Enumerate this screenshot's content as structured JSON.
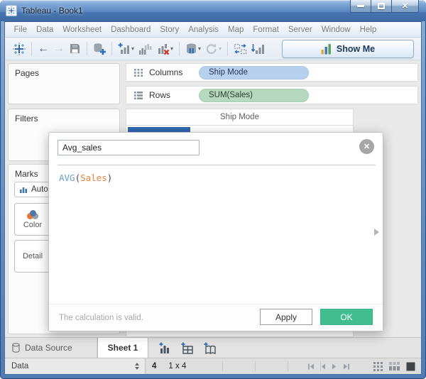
{
  "window": {
    "title": "Tableau - Book1"
  },
  "icons": {
    "minimize": "minimize",
    "maximize": "maximize",
    "close": "✕",
    "caret": "▾",
    "back": "←",
    "forward": "→",
    "dialog_close": "✕"
  },
  "menu": {
    "items": [
      "File",
      "Data",
      "Worksheet",
      "Dashboard",
      "Story",
      "Analysis",
      "Map",
      "Format",
      "Server",
      "Window",
      "Help"
    ]
  },
  "toolbar": {
    "show_me_label": "Show Me"
  },
  "left_panel": {
    "pages_label": "Pages",
    "filters_label": "Filters",
    "marks_label": "Marks",
    "marks_type_label": "Automatic",
    "color_label": "Color",
    "detail_label": "Detail"
  },
  "shelves": {
    "columns_label": "Columns",
    "columns_pill": "Ship Mode",
    "rows_label": "Rows",
    "rows_pill": "SUM(Sales)"
  },
  "worksheet": {
    "column_header": "Ship Mode"
  },
  "dialog": {
    "name_value": "Avg_sales",
    "formula": {
      "function": "AVG",
      "open_paren": "(",
      "field": "Sales",
      "close_paren": ")"
    },
    "status_text": "The calculation is valid.",
    "apply_label": "Apply",
    "ok_label": "OK"
  },
  "bottom_tabs": {
    "data_source_label": "Data Source",
    "sheet_label": "Sheet 1"
  },
  "status_bar": {
    "left_value": "Data",
    "mark_count": "4",
    "grid_size": "1 x 4"
  },
  "colors": {
    "title_bar": "#4f7cb4",
    "dimension_pill": "#b7d0ee",
    "measure_pill": "#b5d8be",
    "chart_bar": "#3166af",
    "ok_button": "#41bd90",
    "formula_function": "#69a1c6",
    "formula_field": "#e8823d"
  }
}
